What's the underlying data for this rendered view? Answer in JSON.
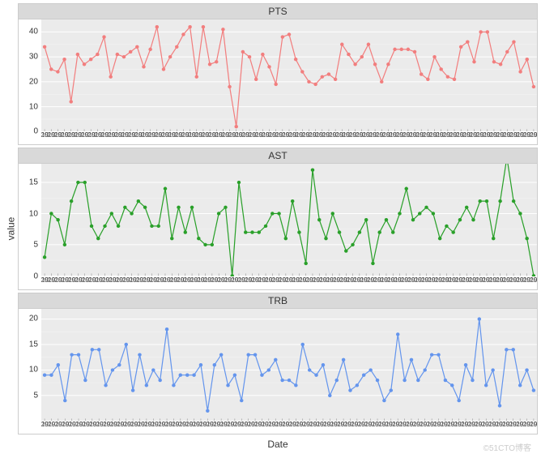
{
  "axis": {
    "x": "Date",
    "y": "value"
  },
  "watermark": "©51CTO博客",
  "facets": [
    "PTS",
    "AST",
    "TRB"
  ],
  "chart_data": [
    {
      "type": "line",
      "title": "PTS",
      "xlabel": "Date",
      "ylabel": "value",
      "ylim": [
        0,
        45
      ],
      "yticks": [
        0,
        10,
        20,
        30,
        40
      ],
      "x_tick_prefix": "2019",
      "color": "#f27e7e",
      "values": [
        34,
        25,
        24,
        29,
        12,
        31,
        27,
        29,
        31,
        38,
        22,
        31,
        30,
        32,
        34,
        26,
        33,
        42,
        25,
        30,
        34,
        39,
        42,
        22,
        42,
        27,
        28,
        41,
        18,
        2,
        32,
        30,
        21,
        31,
        26,
        19,
        38,
        39,
        29,
        24,
        20,
        19,
        22,
        23,
        21,
        35,
        31,
        27,
        30,
        35,
        27,
        20,
        27,
        33,
        33,
        33,
        32,
        23,
        21,
        30,
        25,
        22,
        21,
        34,
        36,
        28,
        40,
        40,
        28,
        27,
        32,
        36,
        24,
        29,
        18
      ]
    },
    {
      "type": "line",
      "title": "AST",
      "xlabel": "Date",
      "ylabel": "value",
      "ylim": [
        0,
        18
      ],
      "yticks": [
        0,
        5,
        10,
        15
      ],
      "x_tick_prefix": "2019",
      "color": "#2aa02a",
      "values": [
        3,
        10,
        9,
        5,
        12,
        15,
        15,
        8,
        6,
        8,
        10,
        8,
        11,
        10,
        12,
        11,
        8,
        8,
        14,
        6,
        11,
        7,
        11,
        6,
        5,
        5,
        10,
        11,
        0,
        15,
        7,
        7,
        7,
        8,
        10,
        10,
        6,
        12,
        7,
        2,
        17,
        9,
        6,
        10,
        7,
        4,
        5,
        7,
        9,
        2,
        7,
        9,
        7,
        10,
        14,
        9,
        10,
        11,
        10,
        6,
        8,
        7,
        9,
        11,
        9,
        12,
        12,
        6,
        12,
        19,
        12,
        10,
        6,
        0
      ]
    },
    {
      "type": "line",
      "title": "TRB",
      "xlabel": "Date",
      "ylabel": "value",
      "ylim": [
        0,
        22
      ],
      "yticks": [
        5,
        10,
        15,
        20
      ],
      "x_tick_prefix": "2019",
      "color": "#6495ed",
      "values": [
        9,
        9,
        11,
        4,
        13,
        13,
        8,
        14,
        14,
        7,
        10,
        11,
        15,
        6,
        13,
        7,
        10,
        8,
        18,
        7,
        9,
        9,
        9,
        11,
        2,
        11,
        13,
        7,
        9,
        4,
        13,
        13,
        9,
        10,
        12,
        8,
        8,
        7,
        15,
        10,
        9,
        11,
        5,
        8,
        12,
        6,
        7,
        9,
        10,
        8,
        4,
        6,
        17,
        8,
        12,
        8,
        10,
        13,
        13,
        8,
        7,
        4,
        11,
        8,
        20,
        7,
        10,
        3,
        14,
        14,
        7,
        10,
        6
      ]
    }
  ]
}
